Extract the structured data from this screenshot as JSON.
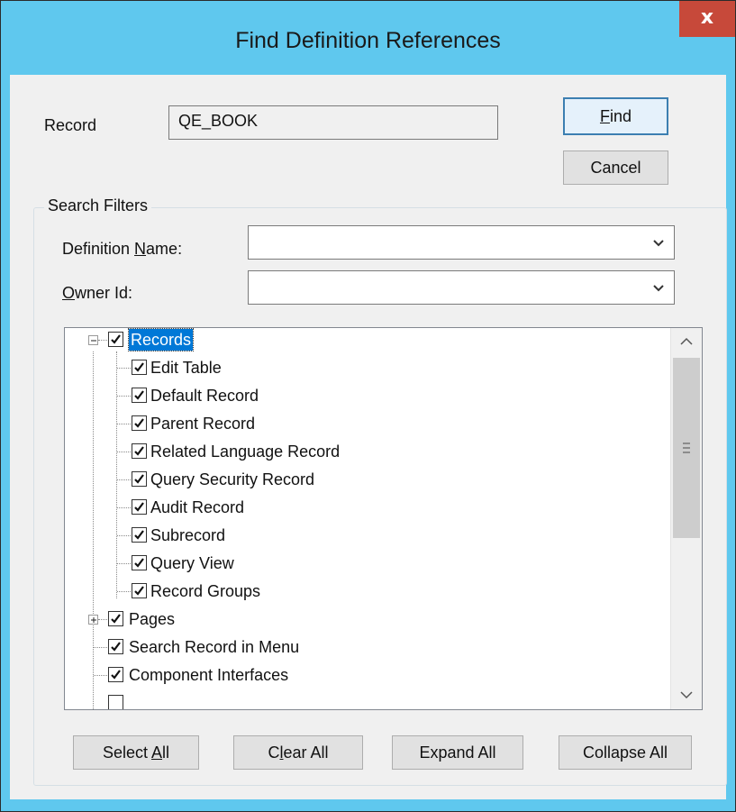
{
  "window": {
    "title": "Find Definition References",
    "close_glyph": "x"
  },
  "record": {
    "label": "Record",
    "value": "QE_BOOK"
  },
  "buttons": {
    "find": {
      "prefix": "",
      "accel": "F",
      "suffix": "ind"
    },
    "cancel": "Cancel"
  },
  "filters": {
    "group_title": "Search Filters",
    "definition_name": {
      "prefix": "Definition ",
      "accel": "N",
      "suffix": "ame:",
      "value": ""
    },
    "owner_id": {
      "prefix": "",
      "accel": "O",
      "suffix": "wner Id:",
      "value": ""
    }
  },
  "tree": {
    "root": {
      "label": "Records",
      "checked": true,
      "expanded": true,
      "selected": true
    },
    "children": [
      {
        "label": "Edit Table",
        "checked": true
      },
      {
        "label": "Default Record",
        "checked": true
      },
      {
        "label": "Parent Record",
        "checked": true
      },
      {
        "label": "Related Language Record",
        "checked": true
      },
      {
        "label": "Query Security Record",
        "checked": true
      },
      {
        "label": "Audit Record",
        "checked": true
      },
      {
        "label": "Subrecord",
        "checked": true
      },
      {
        "label": "Query View",
        "checked": true
      },
      {
        "label": "Record Groups",
        "checked": true
      }
    ],
    "siblings": [
      {
        "label": "Pages",
        "checked": true,
        "expandable": true
      },
      {
        "label": "Search Record in Menu",
        "checked": true
      },
      {
        "label": "Component Interfaces",
        "checked": true
      }
    ]
  },
  "bottom_buttons": {
    "select_all": {
      "prefix": "Select ",
      "accel": "A",
      "suffix": "ll"
    },
    "clear_all": {
      "prefix": "C",
      "accel": "l",
      "suffix": "ear All"
    },
    "expand_all": "Expand All",
    "collapse_all": "Collapse All"
  },
  "colors": {
    "title_bar": "#5fc8ee",
    "close_button": "#c7493a",
    "selection": "#0078d7",
    "dialog_bg": "#f0f0f0"
  }
}
